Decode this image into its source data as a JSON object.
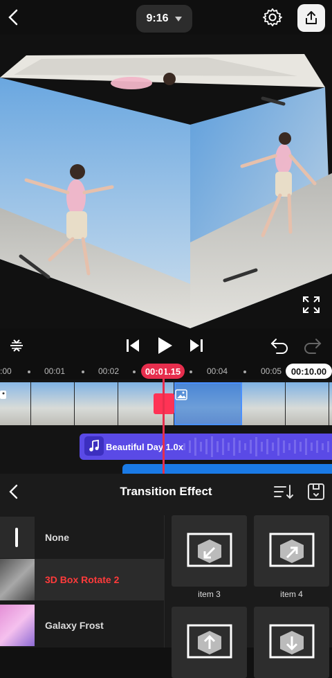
{
  "header": {
    "aspect_ratio": "9:16",
    "icons": [
      "back-chevron-icon",
      "caret-down-icon",
      "gear-icon",
      "share-export-icon"
    ]
  },
  "preview": {
    "icons": [
      "fullscreen-icon"
    ]
  },
  "controls": {
    "icons": [
      "split-icon",
      "skip-back-icon",
      "play-icon",
      "skip-forward-icon",
      "undo-icon",
      "redo-icon"
    ]
  },
  "ruler": {
    "ticks": [
      ":00",
      "00:01",
      "00:02",
      "00:04",
      "00:05"
    ],
    "current_time": "00:01.15",
    "total_time": "00:10.00"
  },
  "timeline": {
    "audio_label": "Beautiful Day 1.0x",
    "icons": [
      "music-note-icon",
      "image-icon"
    ]
  },
  "panel": {
    "title": "Transition Effect",
    "icons": [
      "back-chevron-icon",
      "sort-icon",
      "save-preset-icon"
    ],
    "effects": [
      {
        "label": "None",
        "selected": false
      },
      {
        "label": "3D Box Rotate 2",
        "selected": true
      },
      {
        "label": "Galaxy Frost",
        "selected": false
      }
    ],
    "grid_items": [
      {
        "label": "item 3"
      },
      {
        "label": "item 4"
      },
      {
        "label": ""
      },
      {
        "label": ""
      }
    ]
  },
  "colors": {
    "accent": "#e62e4d",
    "selected_text": "#ff3b3b",
    "audio_track": "#5a4ae6",
    "video_track": "#1a7ae6"
  }
}
